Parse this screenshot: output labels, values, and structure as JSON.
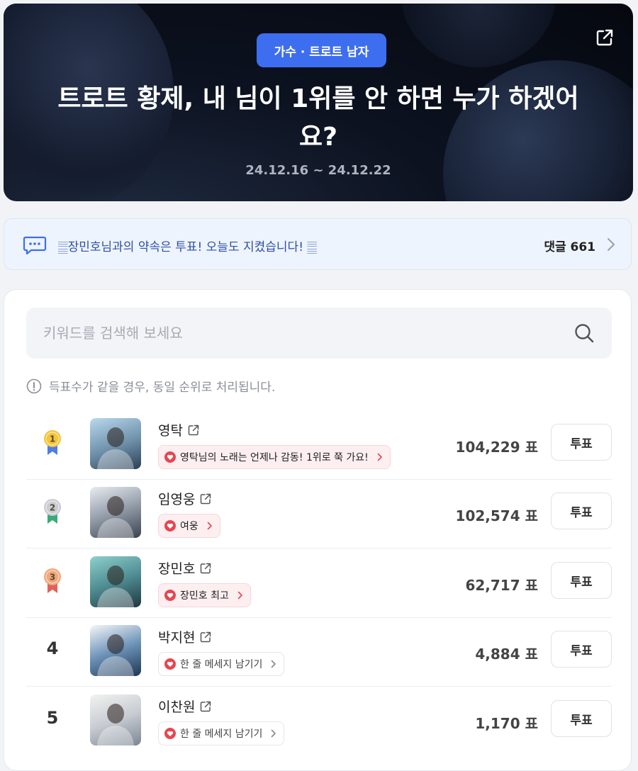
{
  "banner": {
    "category": "가수 · 트로트 남자",
    "title": "트로트 황제, 내 님이 1위를 안 하면 누가 하겠어요?",
    "date_range": "24.12.16 ~ 24.12.22"
  },
  "notice": {
    "text": "𝄛장민호님과의 약속은 투표! 오늘도 지켰습니다! 𝄛",
    "comment_label": "댓글 661"
  },
  "search": {
    "placeholder": "키워드를 검색해 보세요"
  },
  "tie_note": "득표수가 같을 경우, 동일 순위로 처리됩니다.",
  "vote_label": "투표",
  "colors": {
    "accent": "#3d6ef0",
    "gold": "#f3c53a",
    "silver": "#c9ccd2",
    "bronze": "#f0a77a",
    "heart": "#e8454f"
  },
  "rankings": [
    {
      "rank": "1",
      "medal": "gold",
      "name": "영탁",
      "message": "영탁님의 노래는 언제나 감동! 1위로 쭉 가요!",
      "chip": "pink",
      "votes": "104,229 표"
    },
    {
      "rank": "2",
      "medal": "silver",
      "name": "임영웅",
      "message": "여웅",
      "chip": "pink",
      "votes": "102,574 표"
    },
    {
      "rank": "3",
      "medal": "bronze",
      "name": "장민호",
      "message": "장민호 최고",
      "chip": "pink",
      "votes": "62,717 표"
    },
    {
      "rank": "4",
      "medal": "",
      "name": "박지현",
      "message": "한 줄 메세지 남기기",
      "chip": "plain",
      "votes": "4,884 표"
    },
    {
      "rank": "5",
      "medal": "",
      "name": "이찬원",
      "message": "한 줄 메세지 남기기",
      "chip": "plain",
      "votes": "1,170 표"
    }
  ]
}
